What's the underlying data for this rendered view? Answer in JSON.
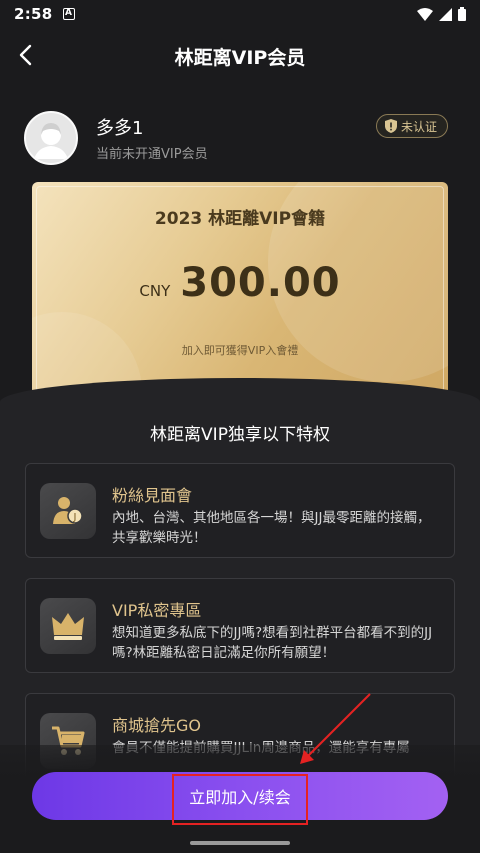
{
  "status_bar": {
    "time": "2:58",
    "app_icon": "A"
  },
  "header": {
    "title": "林距离VIP会员",
    "back_icon": "chevron-left-icon"
  },
  "profile": {
    "username": "多多1",
    "vip_status": "当前未开通VIP会员",
    "badge": "未认证"
  },
  "card": {
    "title": "2023 林距離VIP會籍",
    "currency": "CNY",
    "price": "300.00",
    "note": "加入即可獲得VIP入會禮"
  },
  "section_title": "林距离VIP独享以下特权",
  "features": [
    {
      "title": "粉絲見面會",
      "desc": "內地、台灣、其他地區各一場！與JJ最零距離的接觸，共享歡樂時光！",
      "icon": "fan-meeting-icon"
    },
    {
      "title": "VIP私密專區",
      "desc": "想知道更多私底下的JJ嗎?想看到社群平台都看不到的JJ嗎?林距離私密日記滿足你所有願望！",
      "icon": "crown-icon"
    },
    {
      "title": "商城搶先GO",
      "desc": "會員不僅能提前購買JJLin周邊商品，還能享有專屬",
      "icon": "shopping-cart-icon"
    }
  ],
  "join_button": {
    "label": "立即加入/续会"
  },
  "colors": {
    "accent_gold": "#e0c48d",
    "button_start": "#6d38e6",
    "button_end": "#a361f2",
    "highlight": "#e52222"
  }
}
